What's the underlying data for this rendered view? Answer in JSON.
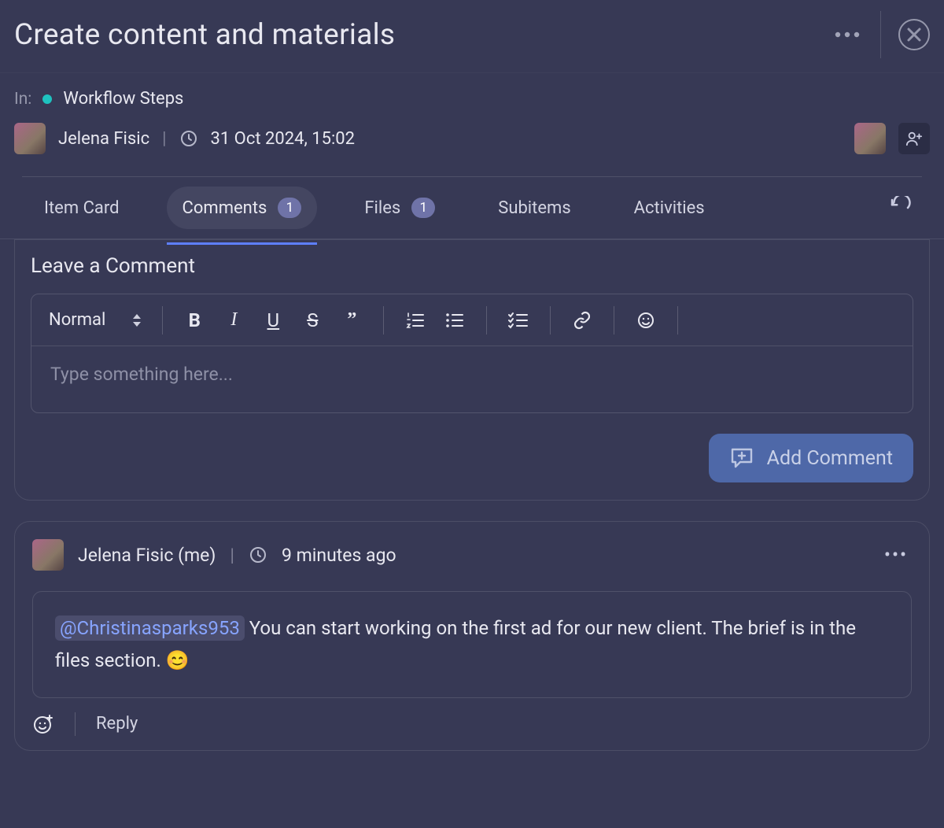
{
  "header": {
    "title": "Create content and materials"
  },
  "meta": {
    "in_label": "In:",
    "board_name": "Workflow Steps",
    "author": "Jelena Fisic",
    "timestamp": "31 Oct 2024, 15:02"
  },
  "tabs": {
    "item_card": "Item Card",
    "comments": "Comments",
    "comments_count": "1",
    "files": "Files",
    "files_count": "1",
    "subitems": "Subitems",
    "activities": "Activities"
  },
  "editor": {
    "section_title": "Leave a Comment",
    "style_select": "Normal",
    "placeholder": "Type something here...",
    "add_button": "Add Comment"
  },
  "comment": {
    "author": "Jelena Fisic (me)",
    "time": "9 minutes ago",
    "mention": "@Christinasparks953",
    "body_rest": " You can start working on the first ad for our new client. The brief is in the files section. ",
    "emoji": "😊",
    "reply_label": "Reply"
  }
}
